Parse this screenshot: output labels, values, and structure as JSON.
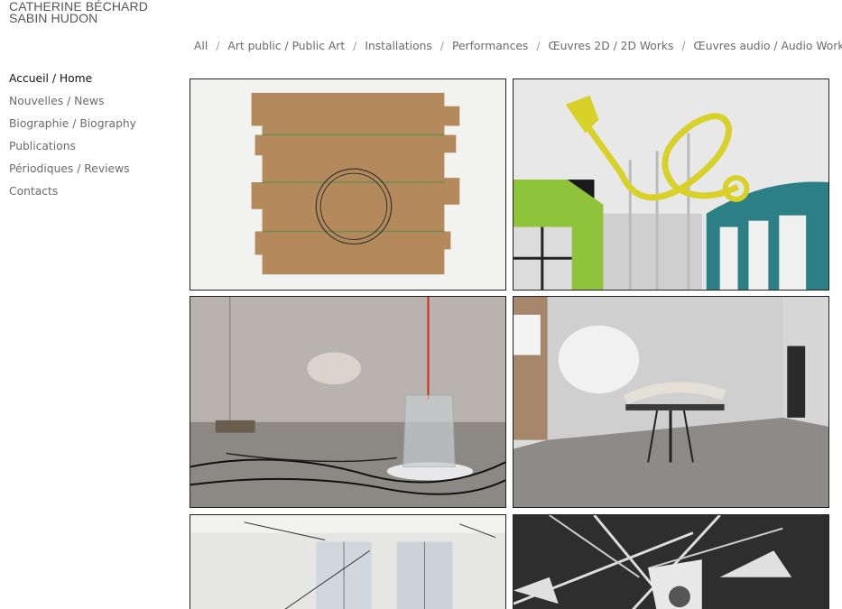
{
  "site": {
    "title_line1": "CATHERINE BÉCHARD",
    "title_line2": "SABIN HUDON"
  },
  "filters": [
    {
      "label": "All"
    },
    {
      "label": "Art public / Public Art"
    },
    {
      "label": "Installations"
    },
    {
      "label": "Performances"
    },
    {
      "label": "Œuvres 2D / 2D Works"
    },
    {
      "label": "Œuvres audio / Audio Works"
    }
  ],
  "separator": "/",
  "nav": [
    {
      "label": "Accueil / Home",
      "active": true
    },
    {
      "label": "Nouvelles / News"
    },
    {
      "label": "Biographie / Biography"
    },
    {
      "label": "Publications"
    },
    {
      "label": "Périodiques / Reviews"
    },
    {
      "label": "Contacts"
    }
  ],
  "gallery": [
    {
      "icon": "cardboard-box-artwork-image"
    },
    {
      "icon": "yellow-horn-sculpture-image"
    },
    {
      "icon": "glass-jar-installation-image"
    },
    {
      "icon": "gallery-table-installation-image"
    },
    {
      "icon": "white-gallery-room-image"
    },
    {
      "icon": "white-cones-sculpture-image"
    }
  ]
}
